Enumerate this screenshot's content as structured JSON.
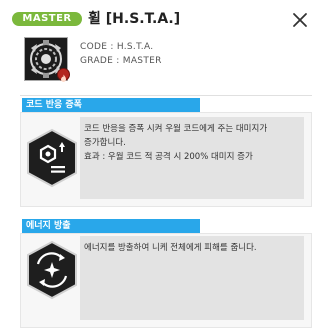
{
  "header": {
    "grade_badge": "MASTER",
    "title": "휠 [H.S.T.A.]",
    "code_line": "CODE : H.S.T.A.",
    "grade_line": "GRADE : MASTER"
  },
  "colors": {
    "badge_green": "#7bb83c",
    "tab_blue": "#29a7ea",
    "icon_dark": "#1e1e1e"
  },
  "sections": [
    {
      "tab_label": "코드 반응 증폭",
      "icon": "hexagon-gear-arrow-icon",
      "description": [
        "코드 반응을 증폭 시켜 우월 코드에게 주는 대미지가",
        "증가합니다.",
        "효과 : 우월 코드 적 공격 시 200% 대미지 증가"
      ]
    },
    {
      "tab_label": "에너지 방출",
      "icon": "energy-burst-icon",
      "description": [
        "에너지를 방출하여 니케 전체에게 피해를 줍니다."
      ]
    }
  ]
}
